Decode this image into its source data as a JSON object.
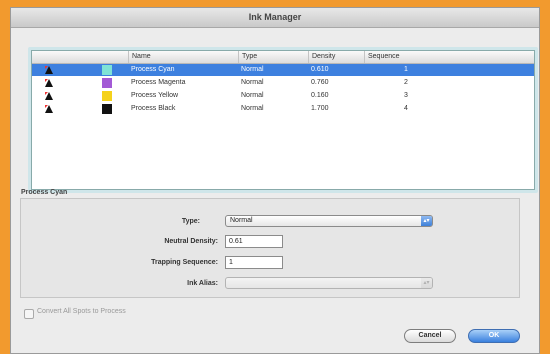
{
  "dialog": {
    "title": "Ink Manager"
  },
  "table": {
    "columns": [
      "Name",
      "Type",
      "Density",
      "Sequence"
    ],
    "rows": [
      {
        "name": "Process Cyan",
        "type": "Normal",
        "density": "0.610",
        "sequence": "1",
        "swatch": "#7fe3d6",
        "selected": true
      },
      {
        "name": "Process Magenta",
        "type": "Normal",
        "density": "0.760",
        "sequence": "2",
        "swatch": "#a35ad6",
        "selected": false
      },
      {
        "name": "Process Yellow",
        "type": "Normal",
        "density": "0.160",
        "sequence": "3",
        "swatch": "#f5d21c",
        "selected": false
      },
      {
        "name": "Process Black",
        "type": "Normal",
        "density": "1.700",
        "sequence": "4",
        "swatch": "#111111",
        "selected": false
      }
    ]
  },
  "details": {
    "section_title": "Process Cyan",
    "type_label": "Type:",
    "type_value": "Normal",
    "density_label": "Neutral Density:",
    "density_value": "0.61",
    "trapping_label": "Trapping Sequence:",
    "trapping_value": "1",
    "alias_label": "Ink Alias:",
    "alias_value": ""
  },
  "checkbox": {
    "label": "Convert All Spots to Process",
    "checked": false
  },
  "buttons": {
    "cancel": "Cancel",
    "ok": "OK"
  },
  "colors": {
    "accent": "#3d80df",
    "background": "#f29a2e"
  }
}
